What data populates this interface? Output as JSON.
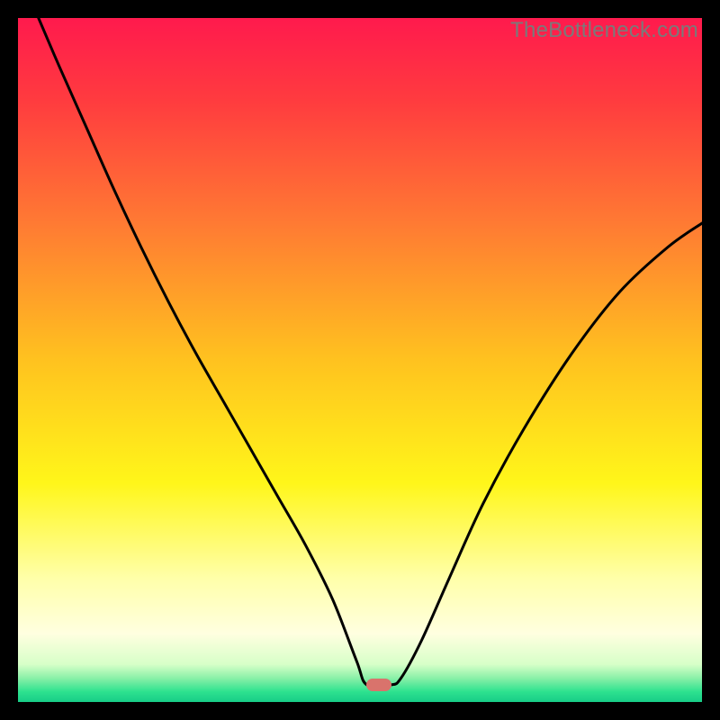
{
  "watermark": "TheBottleneck.com",
  "marker": {
    "x_frac": 0.528,
    "y_frac": 0.975,
    "color": "#d9736c"
  },
  "chart_data": {
    "type": "line",
    "title": "",
    "xlabel": "",
    "ylabel": "",
    "xlim": [
      0,
      1
    ],
    "ylim": [
      0,
      1
    ],
    "grid": false,
    "background_gradient_stops": [
      {
        "offset": 0.0,
        "color": "#ff1a4d"
      },
      {
        "offset": 0.12,
        "color": "#ff3b3f"
      },
      {
        "offset": 0.3,
        "color": "#ff7a33"
      },
      {
        "offset": 0.5,
        "color": "#ffc21f"
      },
      {
        "offset": 0.68,
        "color": "#fff61a"
      },
      {
        "offset": 0.82,
        "color": "#ffffaa"
      },
      {
        "offset": 0.9,
        "color": "#ffffe0"
      },
      {
        "offset": 0.945,
        "color": "#d7ffc8"
      },
      {
        "offset": 0.965,
        "color": "#8af0a8"
      },
      {
        "offset": 0.985,
        "color": "#2de28f"
      },
      {
        "offset": 1.0,
        "color": "#18cc87"
      }
    ],
    "series": [
      {
        "name": "bottleneck-curve",
        "stroke": "#000000",
        "stroke_width": 3,
        "x": [
          0.03,
          0.06,
          0.1,
          0.14,
          0.18,
          0.22,
          0.26,
          0.3,
          0.34,
          0.38,
          0.42,
          0.46,
          0.495,
          0.51,
          0.545,
          0.56,
          0.59,
          0.63,
          0.68,
          0.74,
          0.81,
          0.88,
          0.95,
          1.0
        ],
        "y": [
          1.0,
          0.93,
          0.84,
          0.75,
          0.665,
          0.585,
          0.51,
          0.44,
          0.37,
          0.3,
          0.23,
          0.15,
          0.06,
          0.025,
          0.025,
          0.035,
          0.09,
          0.18,
          0.29,
          0.4,
          0.51,
          0.6,
          0.665,
          0.7
        ]
      }
    ]
  }
}
